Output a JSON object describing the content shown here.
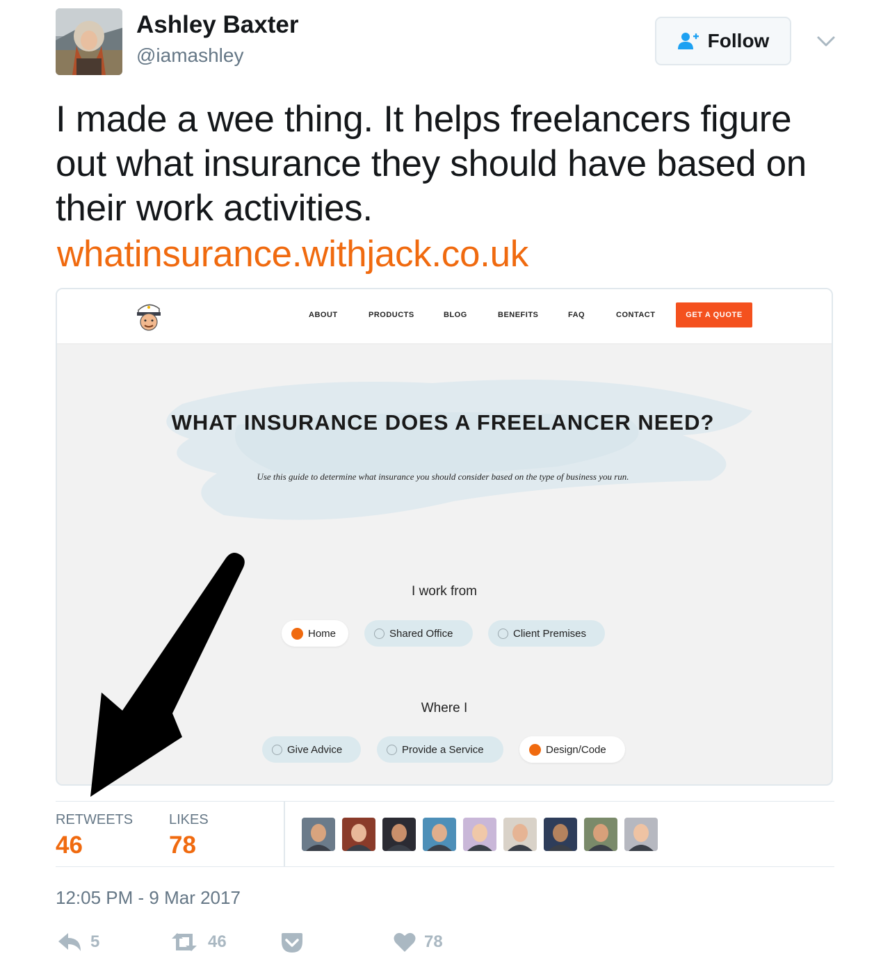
{
  "author": {
    "display_name": "Ashley Baxter",
    "handle": "@iamashley"
  },
  "follow_button": {
    "label": "Follow"
  },
  "tweet": {
    "text": "I made a wee thing. It helps freelancers figure out what insurance they should have based on their work activities.",
    "link": "whatinsurance.withjack.co.uk"
  },
  "card": {
    "nav": [
      "ABOUT",
      "PRODUCTS",
      "BLOG",
      "BENEFITS",
      "FAQ",
      "CONTACT"
    ],
    "cta": "GET A QUOTE",
    "hero_title": "WHAT INSURANCE DOES A FREELANCER NEED?",
    "hero_subtitle": "Use this guide to determine what insurance you should consider based on the type of business you run.",
    "question1": "I work from",
    "options1": [
      {
        "label": "Home",
        "selected": true
      },
      {
        "label": "Shared Office",
        "selected": false
      },
      {
        "label": "Client Premises",
        "selected": false
      }
    ],
    "question2": "Where I",
    "options2": [
      {
        "label": "Give Advice",
        "selected": false
      },
      {
        "label": "Provide a Service",
        "selected": false
      },
      {
        "label": "Design/Code",
        "selected": true
      }
    ],
    "accent_color": "#f4511e"
  },
  "stats": {
    "retweets_label": "RETWEETS",
    "retweets": "46",
    "likes_label": "LIKES",
    "likes": "78",
    "likers_count": 9
  },
  "timestamp": "12:05 PM - 9 Mar 2017",
  "actions": {
    "replies": "5",
    "retweets": "46",
    "likes": "78"
  },
  "colors": {
    "link": "#f06a0f",
    "muted": "#657786",
    "icon": "#aab8c2"
  }
}
